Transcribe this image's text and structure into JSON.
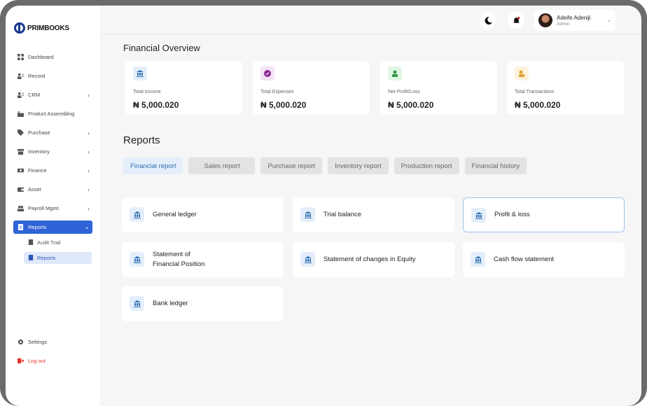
{
  "brand": {
    "name": "PRIMBOOKS"
  },
  "sidebar": {
    "items": [
      {
        "label": "Dashboard",
        "icon": "grid-icon"
      },
      {
        "label": "Record",
        "icon": "users-icon"
      },
      {
        "label": "CRM",
        "icon": "users-icon"
      },
      {
        "label": "Product Assembling",
        "icon": "factory-icon"
      },
      {
        "label": "Purchase",
        "icon": "tag-icon"
      },
      {
        "label": "Inventory",
        "icon": "box-icon"
      },
      {
        "label": "Finance",
        "icon": "money-icon"
      },
      {
        "label": "Asset",
        "icon": "wallet-icon"
      },
      {
        "label": "Payroll Mgmt.",
        "icon": "people-icon"
      },
      {
        "label": "Reports",
        "icon": "document-icon"
      }
    ],
    "sub_items": [
      {
        "label": "Audit Trail"
      },
      {
        "label": "Reports"
      }
    ],
    "settings_label": "Settings",
    "logout_label": "Log out"
  },
  "header": {
    "user_name": "Adeife Adeniji",
    "user_role": "Admin"
  },
  "overview": {
    "title": "Financial Overview",
    "cards": [
      {
        "label": "Total Income",
        "value": "₦ 5,000.020",
        "icon_color": "#e4eefb"
      },
      {
        "label": "Total Expenses",
        "value": "₦ 5,000.020",
        "icon_color": "#f4e3f5"
      },
      {
        "label": "Net Profit/Loss",
        "value": "₦ 5,000.020",
        "icon_color": "#e1f5e4"
      },
      {
        "label": "Total Transactions",
        "value": "₦ 5,000.020",
        "icon_color": "#fdf1dc"
      }
    ]
  },
  "reports": {
    "title": "Reports",
    "tabs": [
      {
        "label": "Financial report"
      },
      {
        "label": "Sales report"
      },
      {
        "label": "Purchase report"
      },
      {
        "label": "Inventory report"
      },
      {
        "label": "Production report"
      },
      {
        "label": "Financial history"
      }
    ],
    "items": [
      {
        "label": "General ledger"
      },
      {
        "label": "Trial balance"
      },
      {
        "label": "Profit & loss"
      },
      {
        "label_line1": "Statement of",
        "label_line2": "Financial Position"
      },
      {
        "label": "Statement of changes in Equity"
      },
      {
        "label": "Cash flow statement"
      },
      {
        "label": "Bank ledger"
      }
    ]
  },
  "colors": {
    "accent": "#2f63d7",
    "logout": "#e3342f"
  }
}
